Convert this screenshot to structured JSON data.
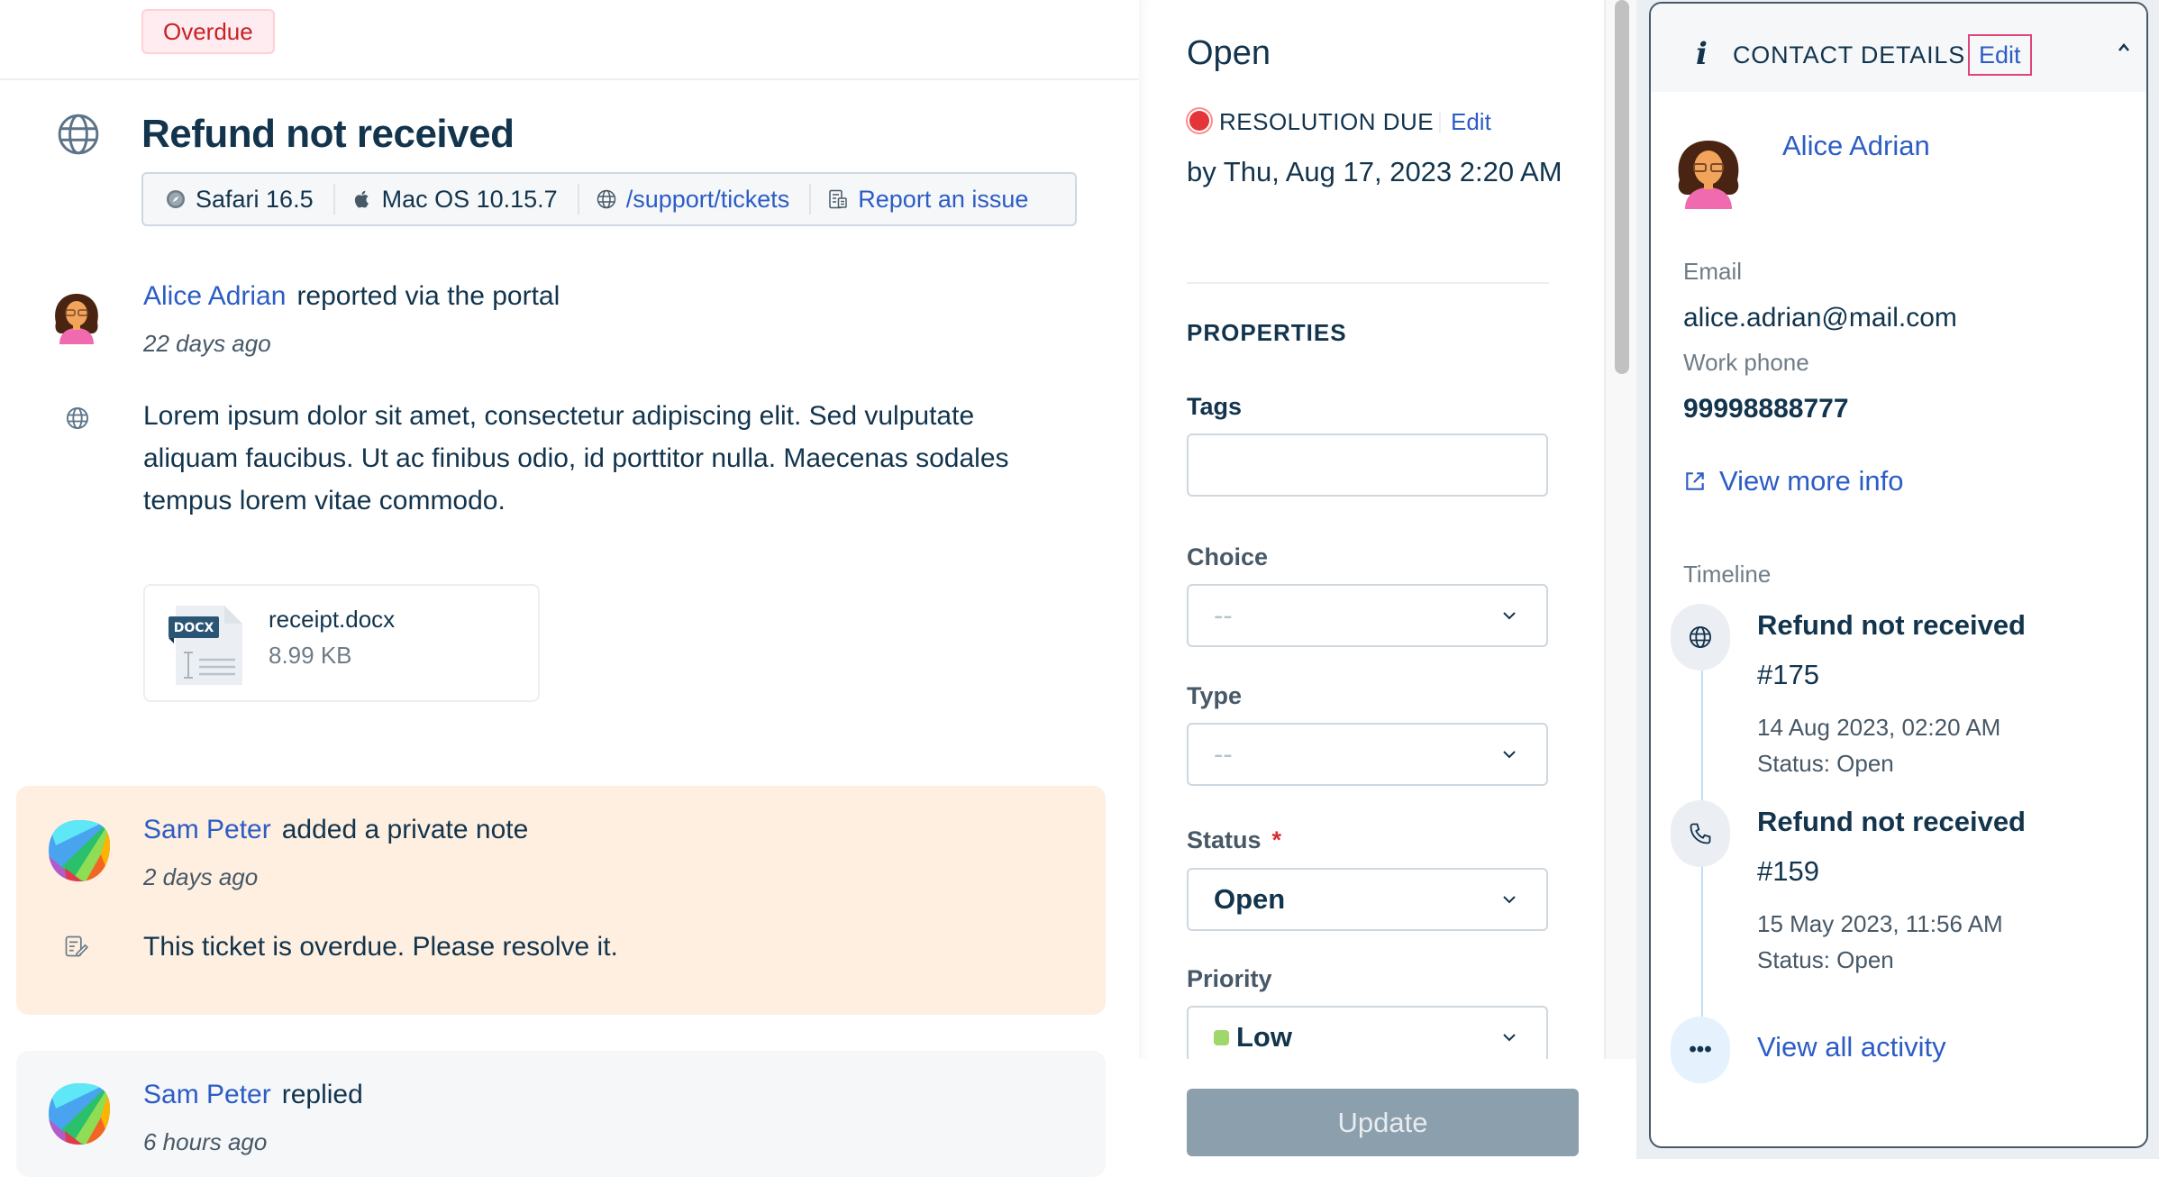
{
  "ticket": {
    "badge": "Overdue",
    "title": "Refund not received",
    "meta": {
      "browser": "Safari 16.5",
      "os": "Mac OS 10.15.7",
      "page_link": "/support/tickets",
      "report_link": "Report an issue"
    }
  },
  "conversation": {
    "initial": {
      "author": "Alice Adrian",
      "action": "reported via the portal",
      "time": "22 days ago",
      "body": "Lorem ipsum dolor sit amet, consectetur adipiscing elit. Sed vulputate aliquam faucibus. Ut ac finibus odio, id porttitor nulla. Maecenas sodales tempus lorem vitae commodo.",
      "attachment": {
        "name": "receipt.docx",
        "size": "8.99 KB",
        "type_label": "DOCX"
      }
    },
    "note": {
      "author": "Sam Peter",
      "action": "added a private note",
      "time": "2 days ago",
      "body": "This ticket is overdue. Please resolve it."
    },
    "reply": {
      "author": "Sam Peter",
      "action": "replied",
      "time": "6 hours ago"
    }
  },
  "properties_panel": {
    "status_heading": "Open",
    "resolution_label": "RESOLUTION DUE",
    "resolution_edit": "Edit",
    "resolution_due": "by Thu, Aug 17, 2023 2:20 AM",
    "section_title": "PROPERTIES",
    "fields": {
      "tags": {
        "label": "Tags",
        "value": ""
      },
      "choice": {
        "label": "Choice",
        "value": "--"
      },
      "type": {
        "label": "Type",
        "value": "--"
      },
      "status": {
        "label": "Status",
        "required_mark": "*",
        "value": "Open"
      },
      "priority": {
        "label": "Priority",
        "value": "Low",
        "color": "#a0d76a"
      }
    },
    "update_button": "Update"
  },
  "contact": {
    "header_title": "CONTACT DETAILS",
    "edit_label": "Edit",
    "name": "Alice Adrian",
    "email_label": "Email",
    "email": "alice.adrian@mail.com",
    "phone_label": "Work phone",
    "phone": "99998888777",
    "view_more": "View more info",
    "timeline_label": "Timeline",
    "timeline": [
      {
        "title": "Refund not received",
        "number": "#175",
        "date": "14 Aug 2023, 02:20 AM",
        "status": "Status: Open",
        "icon": "globe-icon"
      },
      {
        "title": "Refund not received",
        "number": "#159",
        "date": "15 May 2023, 11:56 AM",
        "status": "Status: Open",
        "icon": "phone-icon"
      }
    ],
    "more_glyph": "•••",
    "view_all": "View all activity"
  },
  "colors": {
    "link": "#2c5cc5",
    "text": "#12344d",
    "overdue": "#c82124",
    "note_bg": "#feefe0",
    "resolution_dot": "#e43538",
    "edit_highlight": "#e0447a"
  }
}
